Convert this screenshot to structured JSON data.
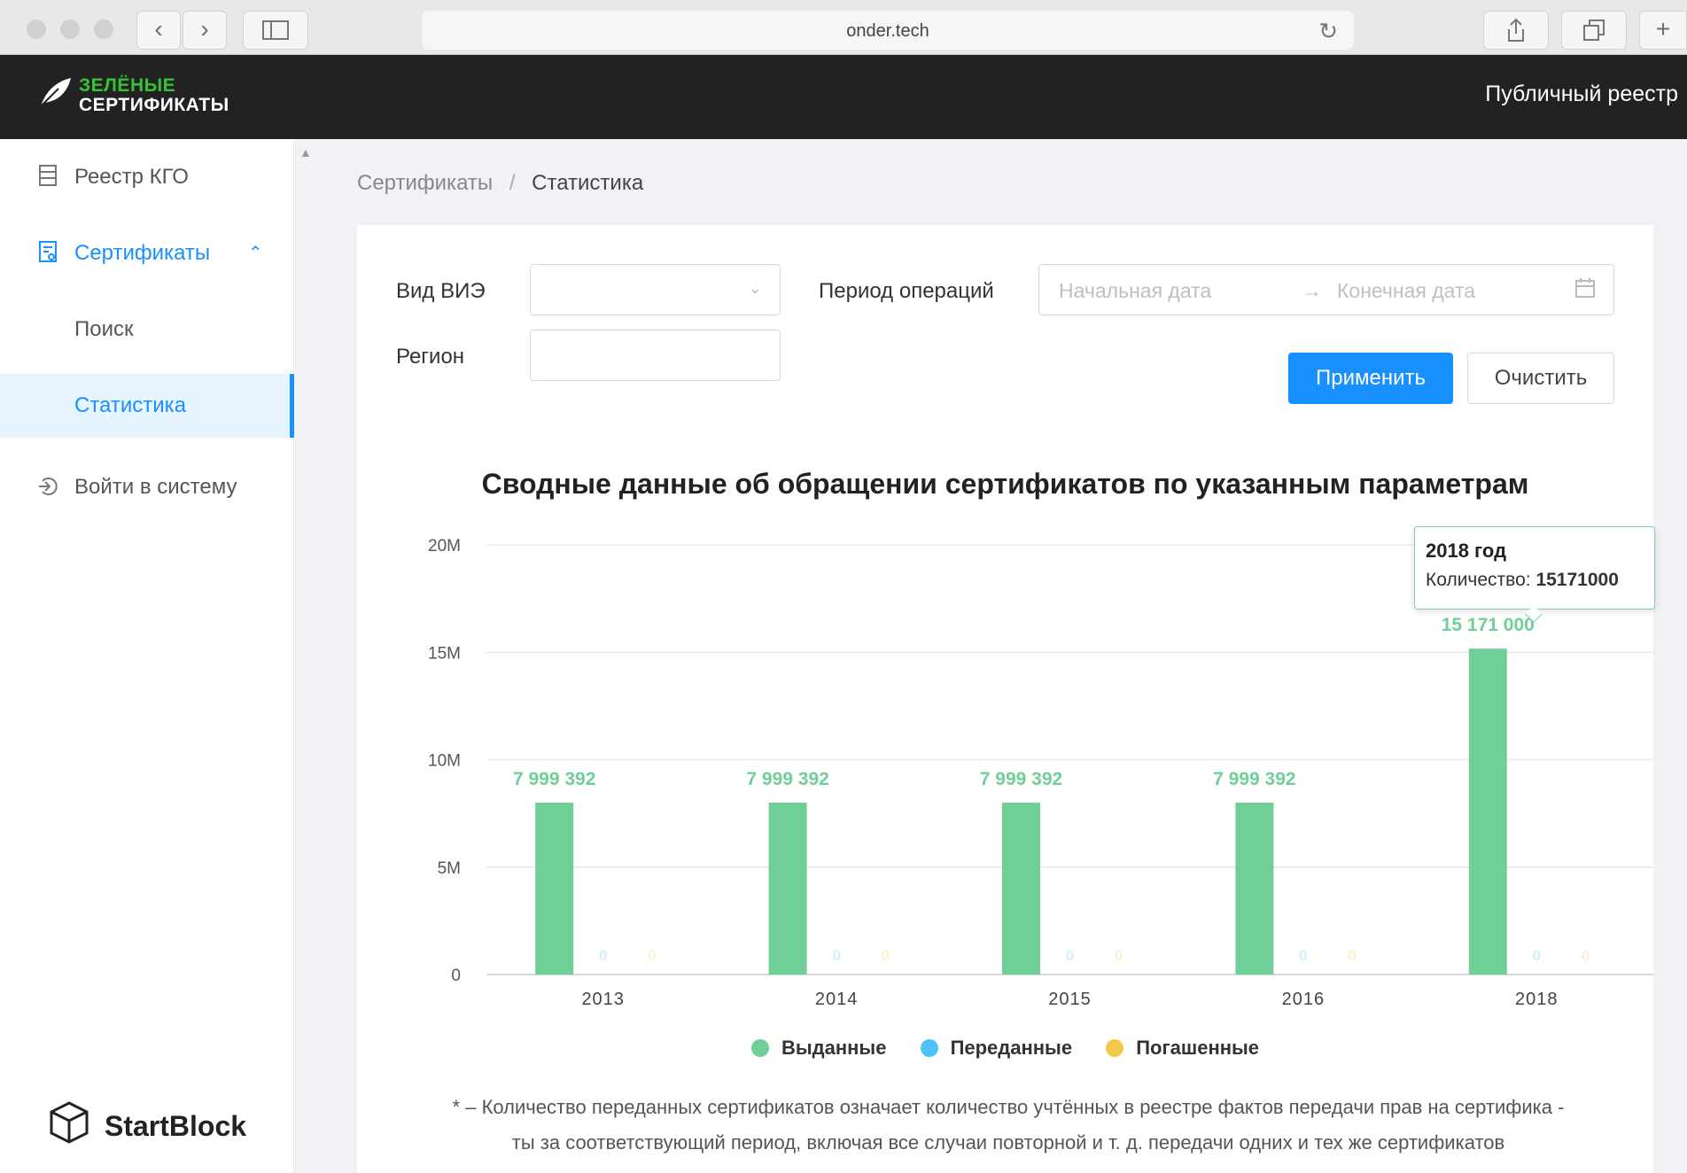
{
  "browser": {
    "url": "onder.tech",
    "reload_icon": "reload-icon",
    "share_icon": "share-icon",
    "tabs_icon": "tabs-icon",
    "new_tab_icon": "plus-icon"
  },
  "header": {
    "logo_line1": "ЗЕЛЁНЫЕ",
    "logo_line2": "СЕРТИФИКАТЫ",
    "public_registry": "Публичный реестр",
    "logo_icon": "leaf-icon"
  },
  "sidebar": {
    "items": [
      {
        "label": "Реестр КГО",
        "icon": "registry-icon"
      },
      {
        "label": "Сертификаты",
        "icon": "certificate-icon"
      },
      {
        "label": "Поиск"
      },
      {
        "label": "Статистика"
      },
      {
        "label": "Войти в систему",
        "icon": "login-icon"
      }
    ],
    "brand": "StartBlock"
  },
  "breadcrumb": {
    "parent": "Сертификаты",
    "separator": "/",
    "current": "Статистика"
  },
  "filters": {
    "type_label": "Вид ВИЭ",
    "period_label": "Период операций",
    "start_placeholder": "Начальная дата",
    "arrow": "→",
    "end_placeholder": "Конечная дата",
    "region_label": "Регион",
    "apply": "Применить",
    "clear": "Очистить"
  },
  "colors": {
    "primary": "#1890ff",
    "issued": "#6fcf97",
    "transferred": "#4fc3f7",
    "redeemed": "#f2c94c"
  },
  "chart_data": {
    "type": "bar",
    "title": "Сводные данные об обращении сертификатов по указанным параметрам",
    "categories": [
      "2013",
      "2014",
      "2015",
      "2016",
      "2018"
    ],
    "series": [
      {
        "name": "Выданные",
        "values": [
          7999392,
          7999392,
          7999392,
          7999392,
          15171000
        ],
        "labels": [
          "7 999 392",
          "7 999 392",
          "7 999 392",
          "7 999 392",
          "15 171 000"
        ]
      },
      {
        "name": "Переданные",
        "values": [
          0,
          0,
          0,
          0,
          0
        ],
        "labels": [
          "0",
          "0",
          "0",
          "0",
          "0"
        ]
      },
      {
        "name": "Погашенные",
        "values": [
          0,
          0,
          0,
          0,
          0
        ],
        "labels": [
          "0",
          "0",
          "0",
          "0",
          "0"
        ]
      }
    ],
    "yticks": [
      "0",
      "5M",
      "10M",
      "15M",
      "20M"
    ],
    "ytick_values": [
      0,
      5000000,
      10000000,
      15000000,
      20000000
    ],
    "ylim": [
      0,
      20000000
    ],
    "grid": true,
    "legend_position": "bottom",
    "tooltip": {
      "title": "2018 год",
      "label": "Количество:",
      "value": "15171000"
    }
  },
  "footnote": {
    "line1": "* – Количество переданных сертификатов означает количество учтённых в реестре фактов передачи прав на сертифика -",
    "line2": "ты за соответствующий период, включая все случаи повторной и т. д. передачи одних и тех же сертификатов"
  }
}
